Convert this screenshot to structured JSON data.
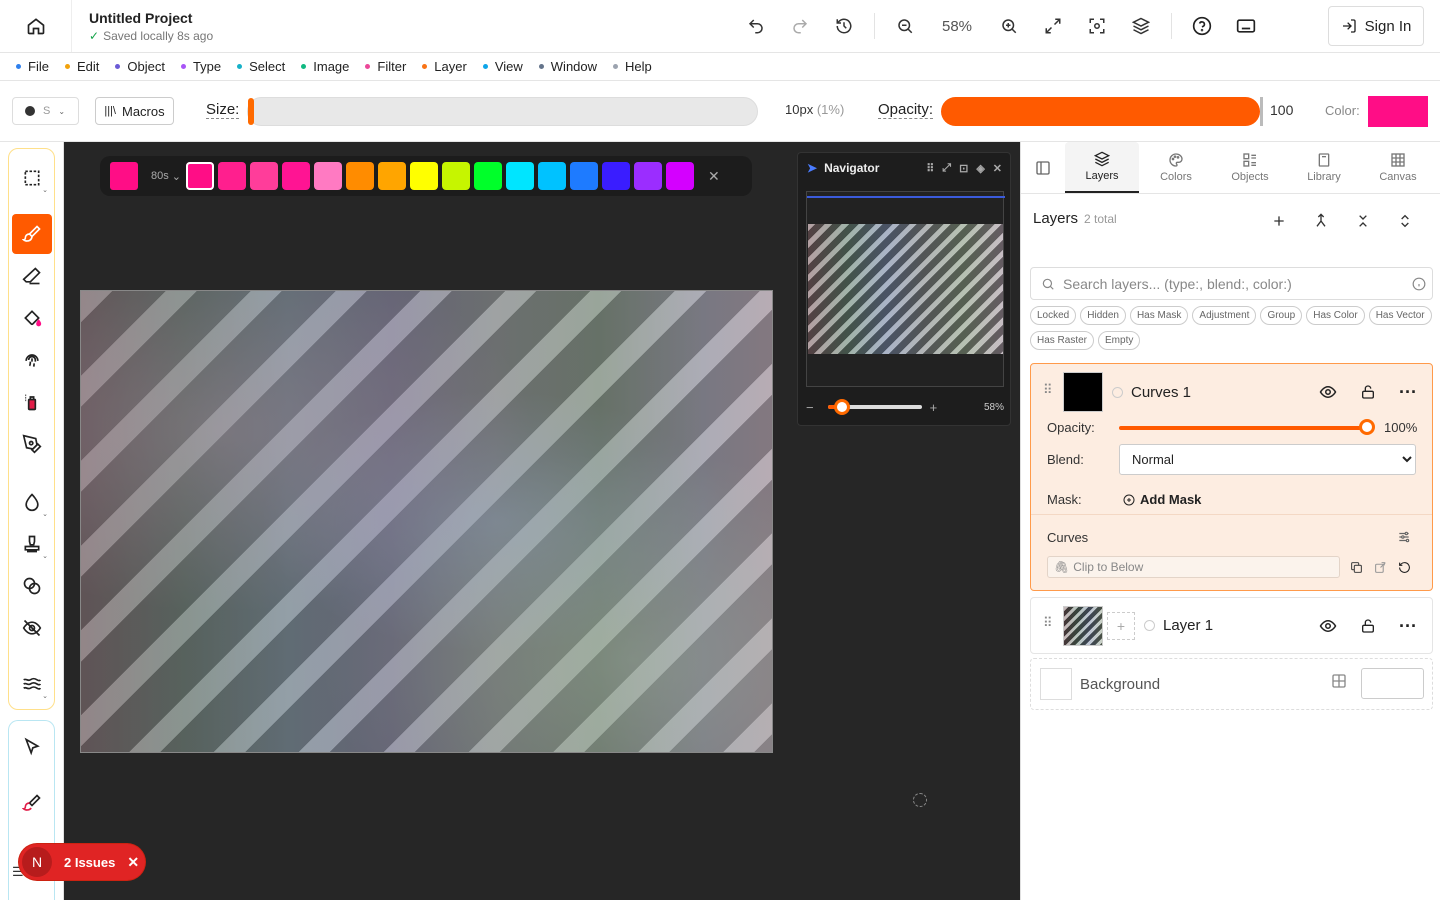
{
  "header": {
    "project_title": "Untitled Project",
    "save_status": "Saved locally 8s ago",
    "zoom": "58%",
    "sign_in": "Sign In"
  },
  "menu": [
    {
      "label": "File",
      "color": "#2f80ed"
    },
    {
      "label": "Edit",
      "color": "#f2a20c"
    },
    {
      "label": "Object",
      "color": "#6b5bd6"
    },
    {
      "label": "Type",
      "color": "#a855f7"
    },
    {
      "label": "Select",
      "color": "#16b1c8"
    },
    {
      "label": "Image",
      "color": "#10b981"
    },
    {
      "label": "Filter",
      "color": "#ec4899"
    },
    {
      "label": "Layer",
      "color": "#f97316"
    },
    {
      "label": "View",
      "color": "#0ea5e9"
    },
    {
      "label": "Window",
      "color": "#64748b"
    },
    {
      "label": "Help",
      "color": "#9ca3af"
    }
  ],
  "options": {
    "brush_preset": "S",
    "macros": "Macros",
    "size_label": "Size:",
    "size_value": "10px",
    "size_percent": "(1%)",
    "size_fraction": 0.01,
    "opacity_label": "Opacity:",
    "opacity_value": "100",
    "color_label": "Color:",
    "color": "#ff0d86"
  },
  "palette": {
    "current": "#ff0d86",
    "selector": "80s",
    "colors": [
      "#ff0d86",
      "#ff1f8e",
      "#ff3d9a",
      "#ff1493",
      "#ff7ac2",
      "#ff8c00",
      "#ffa500",
      "#ffff00",
      "#c6f500",
      "#00ff2a",
      "#00e5ff",
      "#00c2ff",
      "#1e7bff",
      "#3a1dff",
      "#9b2dff",
      "#d400ff"
    ]
  },
  "navigator": {
    "title": "Navigator",
    "zoom": "58%"
  },
  "issues": {
    "badge": "N",
    "label": "2 Issues"
  },
  "right_panel": {
    "tabs": [
      "Layers",
      "Colors",
      "Objects",
      "Library",
      "Canvas"
    ],
    "active_tab": "Layers",
    "layers_title": "Layers",
    "layers_count": "2 total",
    "search_placeholder": "Search layers... (type:, blend:, color:)",
    "chips": [
      "Locked",
      "Hidden",
      "Has Mask",
      "Adjustment",
      "Group",
      "Has Color",
      "Has Vector",
      "Has Raster",
      "Empty"
    ],
    "layer_curves": {
      "name": "Curves 1",
      "opacity_label": "Opacity:",
      "opacity": "100%",
      "blend_label": "Blend:",
      "blend": "Normal",
      "mask_label": "Mask:",
      "add_mask": "Add Mask",
      "curves_label": "Curves",
      "clip_label": "Clip to Below"
    },
    "layer_1": {
      "name": "Layer 1"
    },
    "background": {
      "name": "Background"
    }
  }
}
